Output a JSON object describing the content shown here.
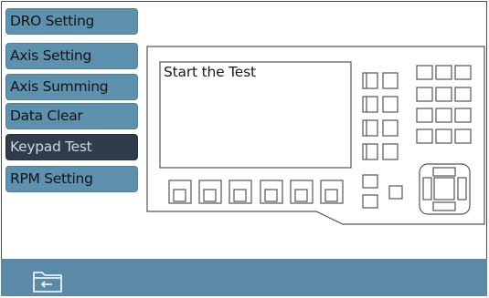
{
  "sidebar": {
    "items": [
      {
        "label": "DRO Setting"
      },
      {
        "label": "Axis Setting"
      },
      {
        "label": "Axis Summing"
      },
      {
        "label": "Data Clear"
      },
      {
        "label": "Keypad Test",
        "active": true
      },
      {
        "label": "RPM Setting"
      }
    ]
  },
  "main": {
    "screen_text": "Start the Test"
  },
  "icons": {
    "back": "folder-back-icon"
  },
  "colors": {
    "menu_bg": "#5e91ad",
    "menu_active_bg": "#2e3c4b",
    "bottom_bar": "#5a8aa8",
    "outline": "#4a4a4a"
  }
}
